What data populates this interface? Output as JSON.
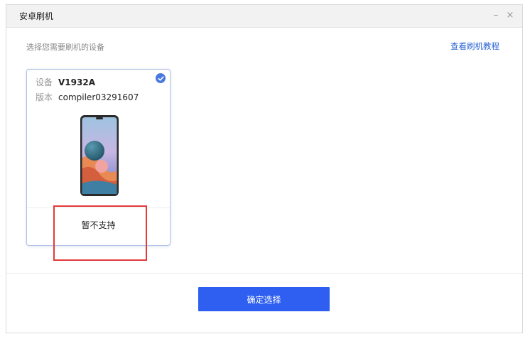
{
  "window": {
    "title": "安卓刷机",
    "minimize_glyph": "–",
    "close_glyph": "×"
  },
  "header": {
    "hint": "选择您需要刷机的设备",
    "tutorial_link": "查看刷机教程"
  },
  "device_card": {
    "device_label": "设备",
    "device_value": "V1932A",
    "version_label": "版本",
    "version_value": "compiler03291607",
    "status_text": "暂不支持",
    "selected": true,
    "check_icon": "checkmark-icon"
  },
  "footer": {
    "confirm_label": "确定选择"
  },
  "colors": {
    "accent": "#2f5ff0",
    "link": "#2a62d6",
    "highlight": "#e23a3a",
    "check": "#4b78de"
  }
}
